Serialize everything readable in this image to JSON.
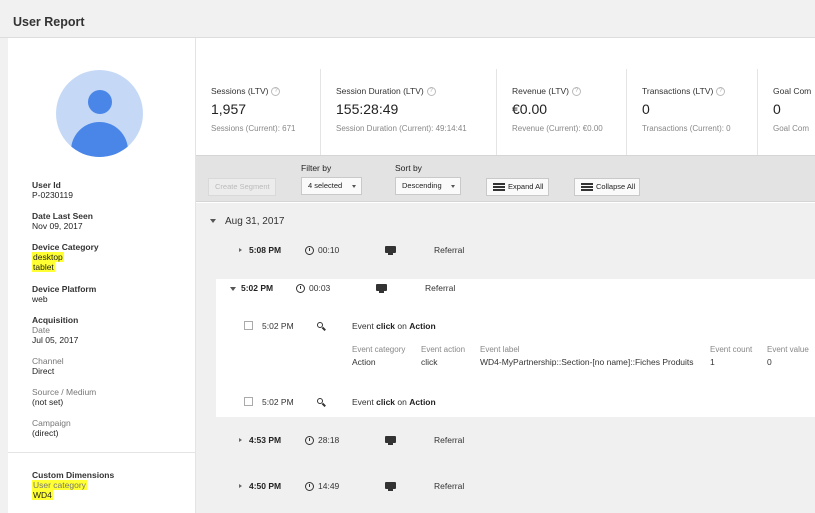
{
  "page": {
    "title": "User Report"
  },
  "user": {
    "user_id": {
      "label": "User Id",
      "value": "P-0230119"
    },
    "date_last_seen": {
      "label": "Date Last Seen",
      "value": "Nov 09, 2017"
    },
    "device_category": {
      "label": "Device Category",
      "values": [
        "desktop",
        "tablet"
      ]
    },
    "device_platform": {
      "label": "Device Platform",
      "value": "web"
    },
    "acquisition": {
      "label": "Acquisition",
      "date_label": "Date",
      "date_value": "Jul 05, 2017",
      "channel_label": "Channel",
      "channel_value": "Direct",
      "source_medium_label": "Source / Medium",
      "source_medium_value": "(not set)",
      "campaign_label": "Campaign",
      "campaign_value": "(direct)"
    },
    "custom_dimensions": {
      "label": "Custom Dimensions",
      "user_category_label": "User category",
      "user_category_value": "WD4"
    }
  },
  "metrics": [
    {
      "title": "Sessions (LTV)",
      "value": "1,957",
      "sub": "Sessions (Current): 671"
    },
    {
      "title": "Session Duration (LTV)",
      "value": "155:28:49",
      "sub": "Session Duration (Current): 49:14:41"
    },
    {
      "title": "Revenue (LTV)",
      "value": "€0.00",
      "sub": "Revenue (Current): €0.00"
    },
    {
      "title": "Transactions (LTV)",
      "value": "0",
      "sub": "Transactions (Current): 0"
    },
    {
      "title": "Goal Com",
      "value": "0",
      "sub": "Goal Com"
    }
  ],
  "toolbar": {
    "create_segment": "Create Segment",
    "filter_label": "Filter by",
    "filter_value": "4 selected",
    "sort_label": "Sort by",
    "sort_value": "Descending",
    "expand_all": "Expand All",
    "collapse_all": "Collapse All"
  },
  "timeline": {
    "date": "Aug 31, 2017",
    "sessions": [
      {
        "time": "5:08 PM",
        "duration": "00:10",
        "source": "Referral"
      },
      {
        "time": "5:02 PM",
        "duration": "00:03",
        "source": "Referral"
      },
      {
        "time": "4:53 PM",
        "duration": "28:18",
        "source": "Referral"
      },
      {
        "time": "4:50 PM",
        "duration": "14:49",
        "source": "Referral"
      }
    ],
    "events": [
      {
        "time": "5:02 PM",
        "prefix": "Event",
        "action_word": "click",
        "on_word": "on",
        "target": "Action"
      },
      {
        "time": "5:02 PM",
        "prefix": "Event",
        "action_word": "click",
        "on_word": "on",
        "target": "Action"
      }
    ],
    "event_details": {
      "headers": [
        "Event category",
        "Event action",
        "Event label",
        "Event count",
        "Event value"
      ],
      "values": [
        "Action",
        "click",
        "WD4-MyPartnership::Section-[no name]::Fiches Produits",
        "1",
        "0"
      ]
    }
  }
}
